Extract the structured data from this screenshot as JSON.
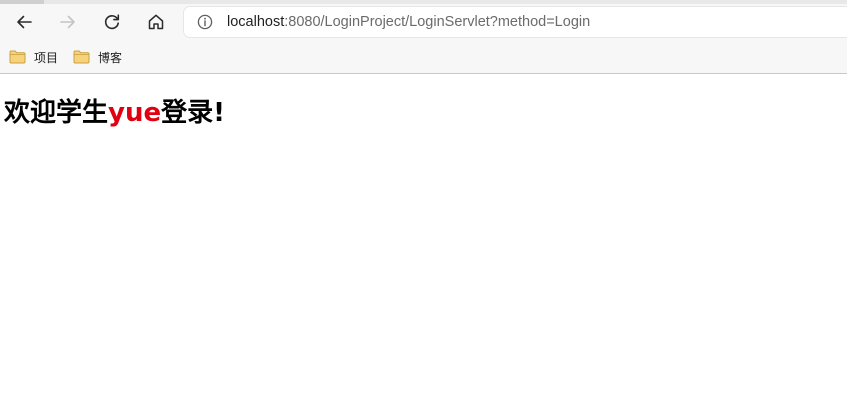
{
  "browser": {
    "address_bar": {
      "host": "localhost",
      "rest": ":8080/LoginProject/LoginServlet?method=Login"
    },
    "bookmarks": [
      {
        "label": "项目",
        "icon": "folder-icon"
      },
      {
        "label": "博客",
        "icon": "folder-icon"
      }
    ],
    "icons": {
      "back": "arrow-left-icon",
      "forward": "arrow-right-icon",
      "reload": "reload-icon",
      "home": "home-icon",
      "site_info": "info-icon"
    }
  },
  "page": {
    "heading_prefix": "欢迎学生",
    "user_name": "yue",
    "heading_suffix": "登录!"
  },
  "colors": {
    "user_name": "#e0000f",
    "folder_fill": "#f6d37a",
    "folder_stroke": "#c9a23f"
  }
}
